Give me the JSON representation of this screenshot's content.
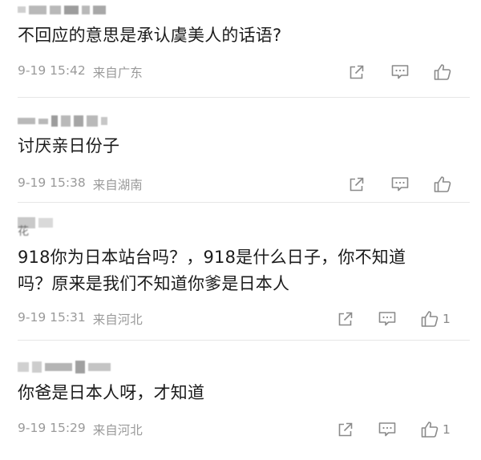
{
  "comments": [
    {
      "username": "",
      "content": "不回应的意思是承认虞美人的话语?",
      "date": "9-19 15:42",
      "location": "来自广东",
      "like_count": ""
    },
    {
      "username": "",
      "content": "讨厌亲日份子",
      "date": "9-19 15:38",
      "location": "来自湖南",
      "like_count": ""
    },
    {
      "username": "花",
      "content": "918你为日本站台吗？，918是什么日子，你不知道\n吗？原来是我们不知道你爹是日本人",
      "date": "9-19 15:31",
      "location": "来自河北",
      "like_count": "1"
    },
    {
      "username": "",
      "content": "你爸是日本人呀，才知道",
      "date": "9-19 15:29",
      "location": "来自河北",
      "like_count": "1"
    }
  ],
  "icons": {
    "share": "share-icon",
    "reply": "comment-icon",
    "like": "thumbs-up-icon"
  },
  "colors": {
    "text": "#1b1b1b",
    "meta": "#9a9a9a",
    "icon": "#8a8a8a",
    "divider": "#e6e6e6"
  }
}
